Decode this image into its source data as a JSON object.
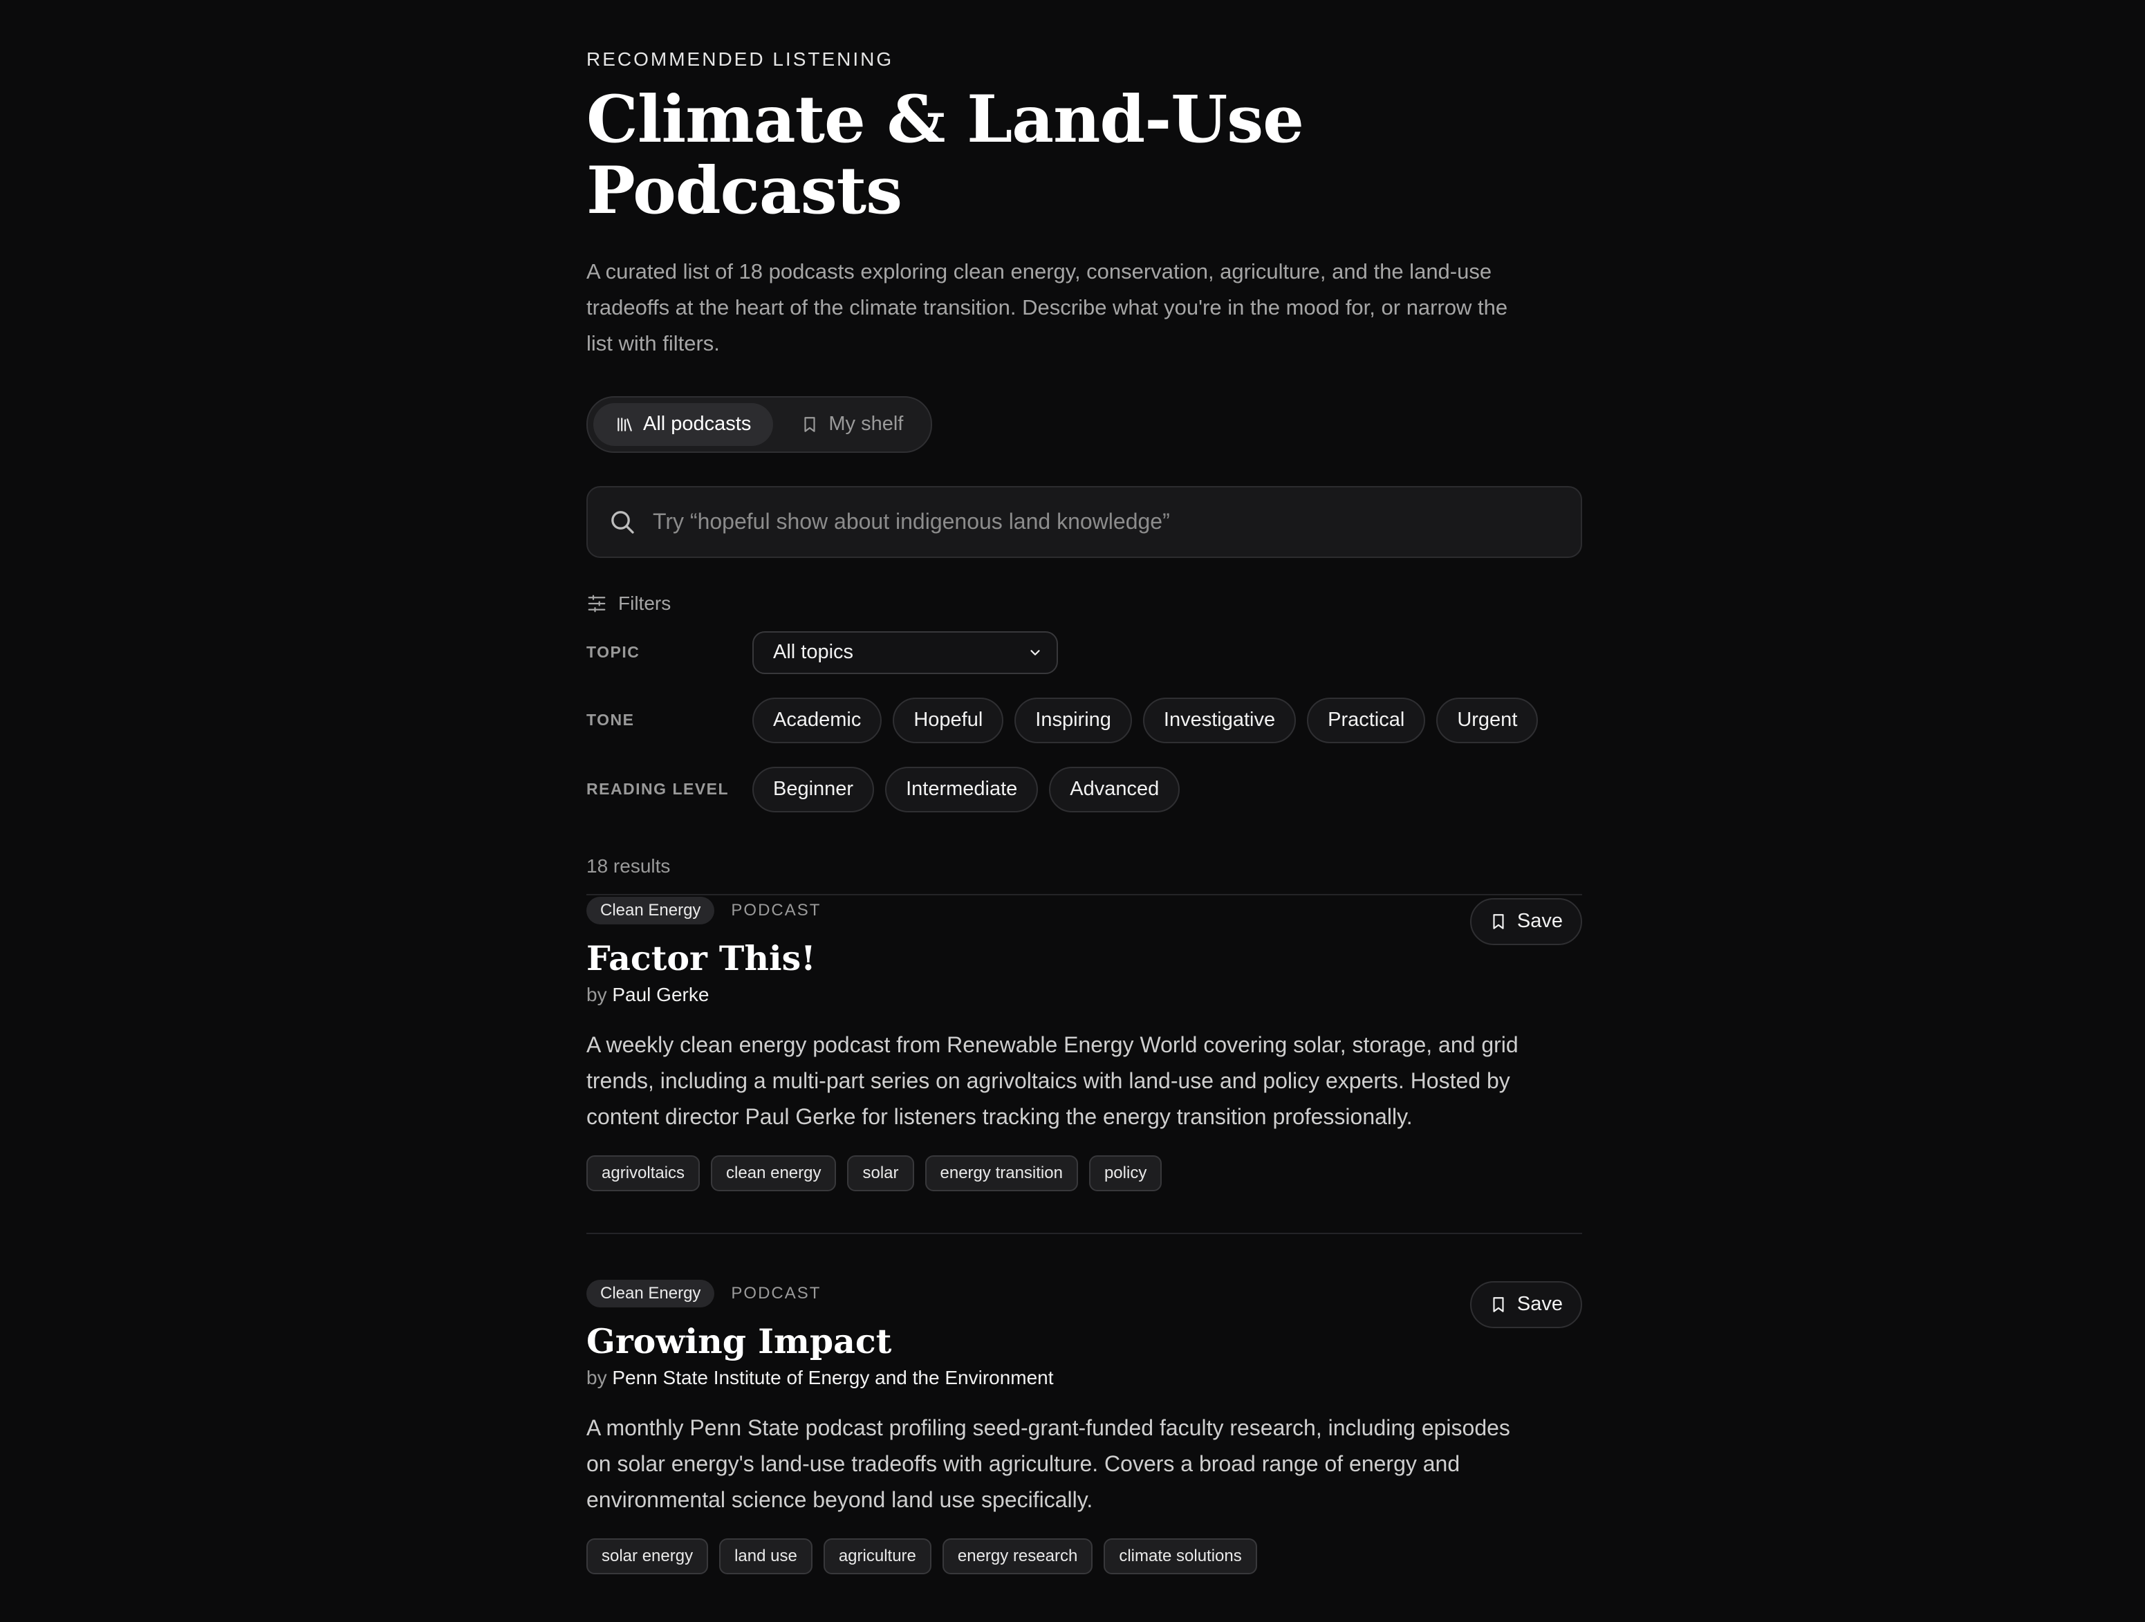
{
  "header": {
    "eyebrow": "RECOMMENDED LISTENING",
    "title": "Climate & Land-Use Podcasts",
    "intro": "A curated list of 18 podcasts exploring clean energy, conservation, agriculture, and the land-use tradeoffs at the heart of the climate transition. Describe what you're in the mood for, or narrow the list with filters."
  },
  "view_toggle": {
    "all": {
      "label": "All podcasts",
      "icon": "library-icon",
      "active": true
    },
    "shelf": {
      "label": "My shelf",
      "icon": "bookmark-icon",
      "active": false
    }
  },
  "search": {
    "placeholder": "Try “hopeful show about indigenous land knowledge”",
    "value": ""
  },
  "filters": {
    "label": "Filters",
    "topic_label": "TOPIC",
    "topic_value": "All topics",
    "tone_label": "TONE",
    "tones": [
      "Academic",
      "Hopeful",
      "Inspiring",
      "Investigative",
      "Practical",
      "Urgent"
    ],
    "level_label": "READING LEVEL",
    "levels": [
      "Beginner",
      "Intermediate",
      "Advanced"
    ]
  },
  "results": {
    "count_text": "18 results",
    "items": [
      {
        "category": "Clean Energy",
        "kind": "PODCAST",
        "save_label": "Save",
        "title": "Factor This!",
        "by": "by",
        "author": "Paul Gerke",
        "description": "A weekly clean energy podcast from Renewable Energy World covering solar, storage, and grid trends, including a multi-part series on agrivoltaics with land-use and policy experts. Hosted by content director Paul Gerke for listeners tracking the energy transition professionally.",
        "tags": [
          "agrivoltaics",
          "clean energy",
          "solar",
          "energy transition",
          "policy"
        ]
      },
      {
        "category": "Clean Energy",
        "kind": "PODCAST",
        "save_label": "Save",
        "title": "Growing Impact",
        "by": "by",
        "author": "Penn State Institute of Energy and the Environment",
        "description": "A monthly Penn State podcast profiling seed-grant-funded faculty research, including episodes on solar energy's land-use tradeoffs with agriculture. Covers a broad range of energy and environmental science beyond land use specifically.",
        "tags": [
          "solar energy",
          "land use",
          "agriculture",
          "energy research",
          "climate solutions"
        ]
      }
    ]
  },
  "colors": {
    "background": "#0b0b0c",
    "text": "#f2f2f2",
    "muted": "#9a9a9a",
    "border": "#2f2f32"
  }
}
